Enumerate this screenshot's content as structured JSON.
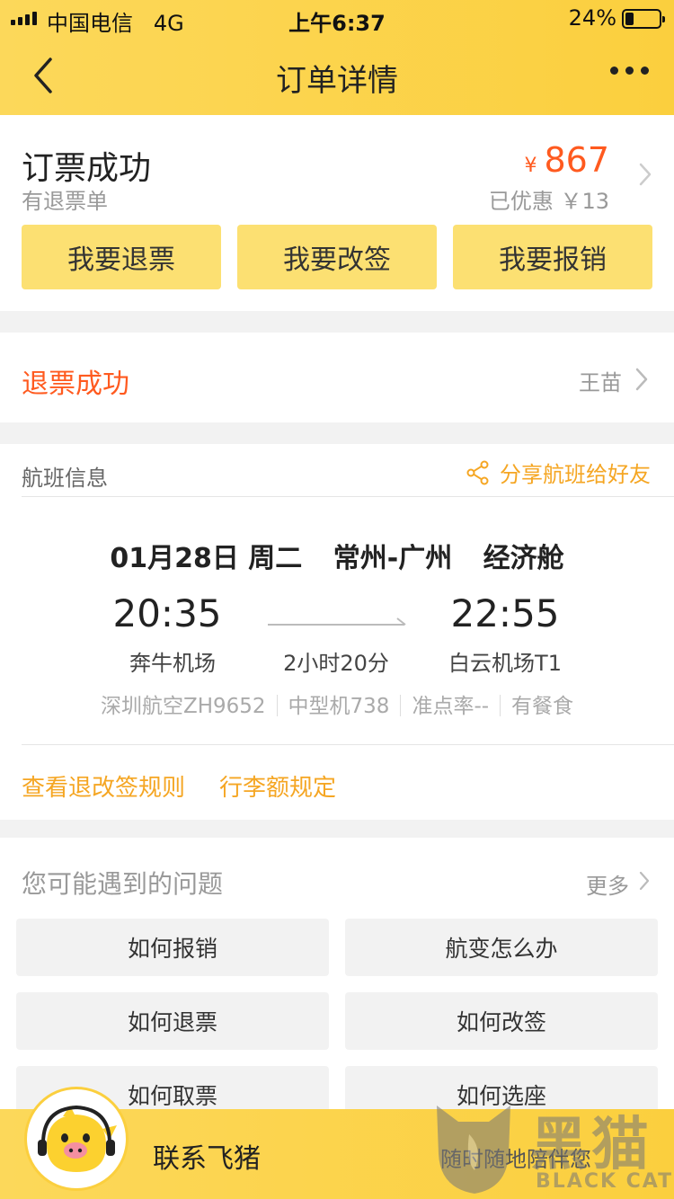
{
  "status_bar": {
    "carrier": "中国电信",
    "network": "4G",
    "time": "上午6:37",
    "battery": "24%"
  },
  "nav": {
    "title": "订单详情"
  },
  "order": {
    "status": "订票成功",
    "sub_status": "有退票单",
    "currency": "¥",
    "price": "867",
    "discount": "已优惠 ￥13",
    "actions": [
      "我要退票",
      "我要改签",
      "我要报销"
    ]
  },
  "refund": {
    "label": "退票成功",
    "passenger": "王苗"
  },
  "flight": {
    "section_title": "航班信息",
    "share": "分享航班给好友",
    "date": "01月28日 周二",
    "route": "常州-广州",
    "cabin": "经济舱",
    "dep_time": "20:35",
    "dep_airport": "奔牛机场",
    "duration": "2小时20分",
    "arr_time": "22:55",
    "arr_airport": "白云机场T1",
    "meta": [
      "深圳航空ZH9652",
      "中型机738",
      "准点率--",
      "有餐食"
    ],
    "links": [
      "查看退改签规则",
      "行李额规定"
    ]
  },
  "faq": {
    "title": "您可能遇到的问题",
    "more": "更多",
    "questions": [
      "如何报销",
      "航变怎么办",
      "如何退票",
      "如何改签",
      "如何取票",
      "如何选座"
    ]
  },
  "bottom": {
    "contact": "联系飞猪",
    "slogan": "随时随地陪伴您"
  },
  "watermark": {
    "brand": "黑猫",
    "brand_en": "BLACK CAT"
  },
  "colors": {
    "brand_yellow": "#fbcf3e",
    "button_yellow": "#fce072",
    "accent_orange": "#ff5a1f",
    "link_orange": "#f5a623"
  }
}
